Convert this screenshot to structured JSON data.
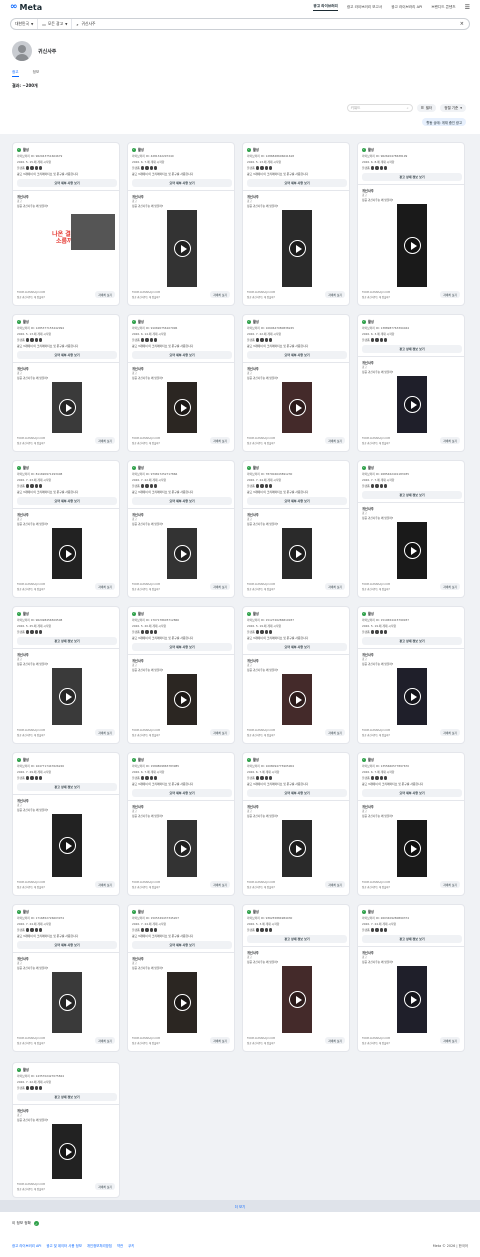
{
  "header": {
    "logo": "Meta",
    "nav": [
      "광고 라이브러리",
      "광고 라이브러리 보고서",
      "광고 라이브러리 API",
      "브랜디드 콘텐츠"
    ]
  },
  "search": {
    "country": "대한민국",
    "ad_category": "모든 광고",
    "query": "귀신사주"
  },
  "profile": {
    "name": "귀신사주",
    "tabs": [
      "광고",
      "정보"
    ]
  },
  "results_label": "결과: ~200개",
  "sort": {
    "search_placeholder": "키워드",
    "filter_label": "필터",
    "sort_label": "정렬 기준",
    "active_filter": "활동 상태: 게재 중인 광고"
  },
  "common": {
    "status": "활성",
    "platforms_label": "플랫폼",
    "multi_text": "광고 3개에서 이 크리에이티브 및 문구를 사용합니다",
    "summary_button": "요약 세부 사항 보기",
    "ad_details_button": "광고 상세 정보 보기",
    "advertiser": "귀신사주",
    "sponsored": "광고",
    "body": "정공 귀신사주는 왜 맞을까?",
    "details_button": "자세히 보기",
    "footer_url": "FORM.GUISINSAJU.COM"
  },
  "cards": [
    {
      "id": "라이브러리 ID: 962043751604679",
      "date": "2026. 5. 15.에 게재 시작함"
    },
    {
      "id": "라이브러리 ID: 4281342297240",
      "date": "2026. 6. 7.에 게재 시작함"
    },
    {
      "id": "라이브러리 ID: 1286848606641618",
      "date": "2026. 5. 13.에 게재 시작함"
    },
    {
      "id": "라이브러리 ID: 962620478638199",
      "date": "2026. 6. 8.에 게재 시작함"
    },
    {
      "id": "라이브러리 ID: 1285377155442994",
      "date": "2026. 5. 13.에 게재 시작함"
    },
    {
      "id": "라이브러리 ID: 910690756107996",
      "date": "2026. 6. 14.에 게재 시작함"
    },
    {
      "id": "라이브러리 ID: 1060647080838245",
      "date": "2026. 7. 22.에 게재 시작함"
    },
    {
      "id": "라이브러리 ID: 1388987763394044",
      "date": "2026. 6. 3.에 게재 시작함"
    },
    {
      "id": "라이브러리 ID: 811690971293408",
      "date": "2026. 7. 23.에 게재 시작함"
    },
    {
      "id": "라이브러리 ID: 979817252717866",
      "date": "2026. 7. 22.에 게재 시작함"
    },
    {
      "id": "라이브러리 ID: 787004643891230",
      "date": "2026. 7. 24.에 게재 시작함"
    },
    {
      "id": "라이브러리 ID: 2685462401183035",
      "date": "2026. 7. 7.에 게재 시작함"
    },
    {
      "id": "라이브러리 ID: 962498456509508",
      "date": "2026. 5. 25.에 게재 시작함"
    },
    {
      "id": "라이브러리 ID: 1707178605712866",
      "date": "2026. 5. 20.에 게재 시작함"
    },
    {
      "id": "라이브러리 ID: 1512726286819937",
      "date": "2026. 5. 19.에 게재 시작함"
    },
    {
      "id": "라이브러리 ID: 1519654415799937",
      "date": "2026. 5. 19.에 게재 시작함"
    },
    {
      "id": "라이브러리 ID: 1647717447626226",
      "date": "2026. 7. 29.에 게재 시작함"
    },
    {
      "id": "라이브러리 ID: 1589809865783985",
      "date": "2026. 6. 7.에 게재 시작함"
    },
    {
      "id": "라이브러리 ID: 1008094775905904",
      "date": "2026. 6. 7.에 게재 시작함"
    },
    {
      "id": "라이브러리 ID: 1355660577897670",
      "date": "2026. 6. 7.에 게재 시작함"
    },
    {
      "id": "라이브러리 ID: 1716852726603974",
      "date": "2026. 7. 24.에 게재 시작함"
    },
    {
      "id": "라이브러리 ID: 1505349437345207",
      "date": "2026. 7. 24.에 게재 시작함"
    },
    {
      "id": "라이브러리 ID: 936255884984030",
      "date": "2026. 5. 3.에 게재 시작함"
    },
    {
      "id": "라이브러리 ID: 2603409280899374",
      "date": "2026. 7. 24.에 게재 시작함"
    },
    {
      "id": "라이브러리 ID: 1435702427075824",
      "date": "2026. 7. 22.에 게재 시작함"
    }
  ],
  "card1_overlay": [
    "나온 결과가",
    "소름끼침"
  ],
  "pager": "더 보기",
  "footer": {
    "lang": "이 정보 정확",
    "links": [
      "광고 라이브러리 API",
      "광고 및 데이터 사용 정보",
      "개인정보처리방침",
      "약관",
      "쿠키"
    ],
    "copyright": "Meta © 2026 | 한국어"
  }
}
